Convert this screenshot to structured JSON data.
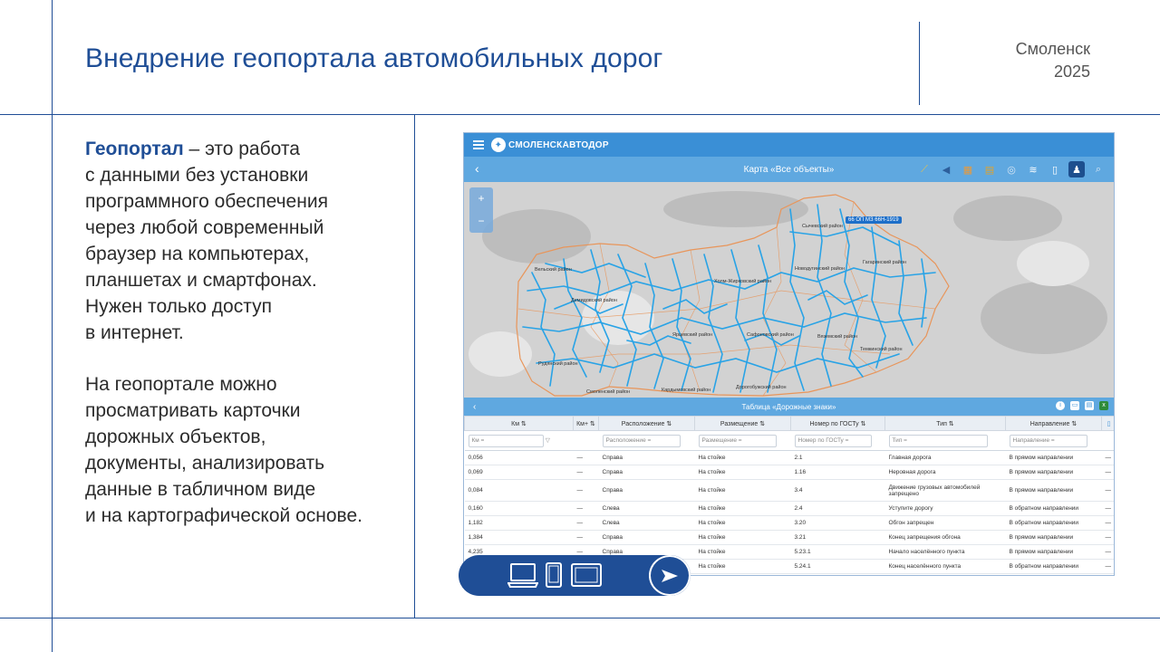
{
  "slide": {
    "title": "Внедрение геопортала автомобильных дорог",
    "city": "Смоленск",
    "year": "2025"
  },
  "text": {
    "p1_strong": "Геопортал",
    "p1_lines": [
      " – это работа",
      "с данными без установки",
      "программного обеспечения",
      "через любой современный",
      "браузер на компьютерах,",
      "планшетах и смартфонах.",
      "Нужен только доступ",
      "в интернет."
    ],
    "p2_lines": [
      "На геопортале можно",
      "просматривать карточки",
      "дорожных объектов,",
      "документы, анализировать",
      "данные в табличном виде",
      "и на картографической основе."
    ]
  },
  "app": {
    "brand": "СМОЛЕНСКАВТОДОР",
    "map_title": "Карта «Все объекты»",
    "road_tag": "66 ОП МЗ 66Н-1919",
    "zoom_in": "+",
    "zoom_out": "−",
    "districts": [
      "Сычевский район",
      "Гагаринский район",
      "Новодугинский район",
      "Холм-Жирковский район",
      "Вельский район",
      "Демидовский район",
      "Ярцевский район",
      "Сафоновский район",
      "Вяземский район",
      "Темкинский район",
      "Рудянский район",
      "Смоленский район",
      "Кардымовский район",
      "Дорогобужский район"
    ],
    "table_title": "Таблица «Дорожные знаки»",
    "columns": [
      "Км ⇅",
      "Км+ ⇅",
      "Расположение ⇅",
      "Размещение ⇅",
      "Номер по ГОСТу ⇅",
      "Тип ⇅",
      "Направление ⇅",
      "▯"
    ],
    "filters": [
      "Км =",
      "",
      "Расположение =",
      "Размещение =",
      "Номер по ГОСТу =",
      "Тип =",
      "Направление ="
    ],
    "rows": [
      [
        "0,056",
        "—",
        "Справа",
        "На стойке",
        "2.1",
        "Главная дорога",
        "В прямом направлении",
        "—"
      ],
      [
        "0,069",
        "—",
        "Справа",
        "На стойке",
        "1.16",
        "Неровная дорога",
        "В прямом направлении",
        "—"
      ],
      [
        "0,084",
        "—",
        "Справа",
        "На стойке",
        "3.4",
        "Движение грузовых автомобилей запрещено",
        "В прямом направлении",
        "—"
      ],
      [
        "0,160",
        "—",
        "Слева",
        "На стойке",
        "2.4",
        "Уступите дорогу",
        "В обратном направлении",
        "—"
      ],
      [
        "1,182",
        "—",
        "Слева",
        "На стойке",
        "3.20",
        "Обгон запрещен",
        "В обратном направлении",
        "—"
      ],
      [
        "1,384",
        "—",
        "Справа",
        "На стойке",
        "3.21",
        "Конец запрещения обгона",
        "В прямом направлении",
        "—"
      ],
      [
        "4,235",
        "—",
        "Справа",
        "На стойке",
        "5.23.1",
        "Начало населённого пункта",
        "В прямом направлении",
        "—"
      ],
      [
        "",
        "",
        "",
        "На стойке",
        "5.24.1",
        "Конец населённого пункта",
        "В обратном направлении",
        "—"
      ]
    ]
  },
  "colors": {
    "brand_blue": "#1f4e96",
    "road_blue": "#29a3e6",
    "district_orange": "#e8955a"
  }
}
